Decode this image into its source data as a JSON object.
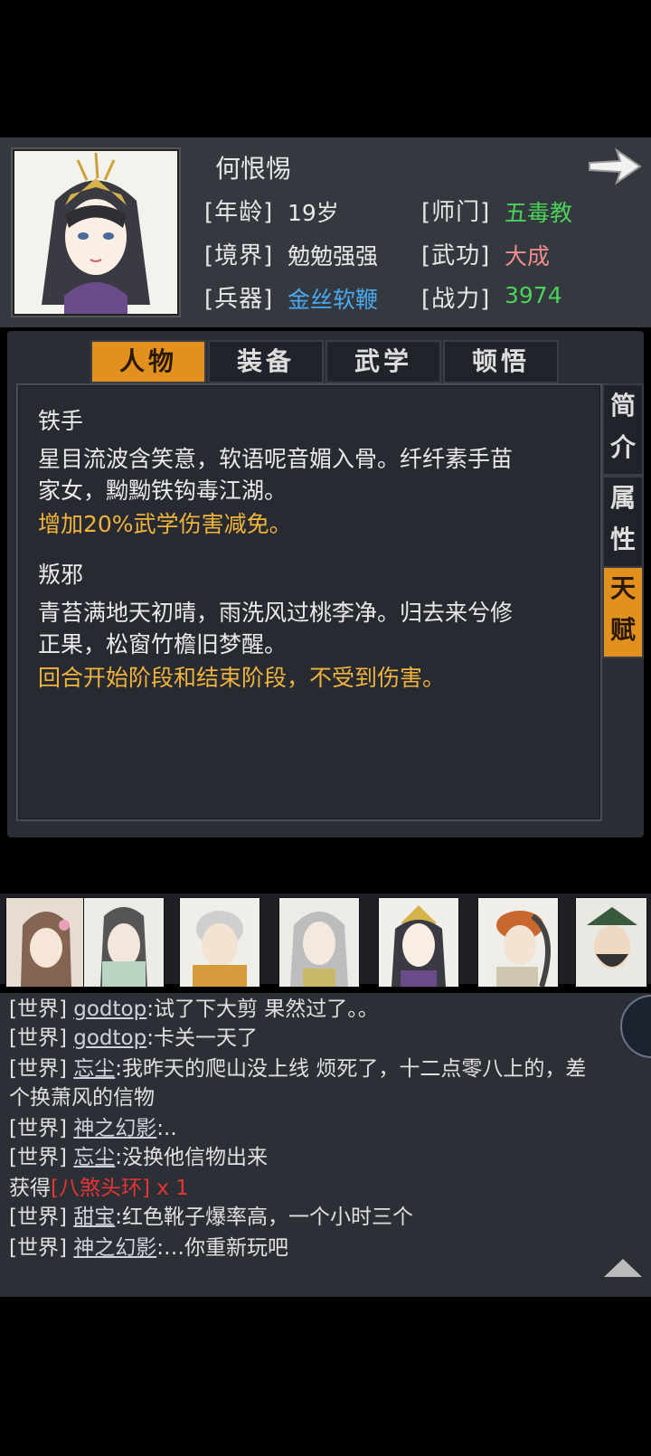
{
  "character": {
    "name": "何恨惕",
    "stats": [
      {
        "label": "[年龄]",
        "value": "19岁",
        "color": "#e6e6e6"
      },
      {
        "label": "[师门]",
        "value": "五毒教",
        "color": "#4cd25a"
      },
      {
        "label": "[境界]",
        "value": "勉勉强强",
        "color": "#e6e6e6"
      },
      {
        "label": "[武功]",
        "value": "大成",
        "color": "#f08c8c"
      },
      {
        "label": "[兵器]",
        "value": "金丝软鞭",
        "color": "#4aa8f0"
      },
      {
        "label": "[战力]",
        "value": "3974",
        "color": "#4cd25a"
      }
    ]
  },
  "tabs": [
    "人物",
    "装备",
    "武学",
    "顿悟"
  ],
  "active_tab": "人物",
  "side_tabs": [
    "简介",
    "属性",
    "天赋"
  ],
  "active_side_tab": "天赋",
  "talents": [
    {
      "name": "铁手",
      "desc_line1": "星目流波含笑意，软语呢音媚入骨。纤纤素手苗",
      "desc_line2": "家女，黝黝铁钩毒江湖。",
      "effect": "增加20%武学伤害减免。"
    },
    {
      "name": "叛邪",
      "desc_line1": "青苔满地天初晴，雨洗风过桃李净。归去来兮修",
      "desc_line2": "正果，松窗竹檐旧梦醒。",
      "effect": "回合开始阶段和结束阶段，不受到伤害。"
    }
  ],
  "chat": [
    {
      "channel": "[世界]",
      "player": "godtop",
      "msg": ":试了下大剪 果然过了。。"
    },
    {
      "channel": "[世界]",
      "player": "godtop",
      "msg": ":卡关一天了"
    },
    {
      "channel": "[世界]",
      "player": "忘尘",
      "msg": ":我昨天的爬山没上线 烦死了，十二点零八上的，差"
    },
    {
      "channel": "",
      "player": "",
      "msg": "个换萧风的信物"
    },
    {
      "channel": "[世界]",
      "player": "神之幻影",
      "msg": ":.."
    },
    {
      "channel": "[世界]",
      "player": "忘尘",
      "msg": ":没换他信物出来"
    },
    {
      "channel": "获得",
      "player": "",
      "msg": "",
      "item": "[八煞头环]",
      "count": " x 1"
    },
    {
      "channel": "[世界]",
      "player": "甜宝",
      "msg": ":红色靴子爆率高，一个小时三个"
    },
    {
      "channel": "[世界]",
      "player": "神之幻影",
      "msg": ":…你重新玩吧"
    }
  ]
}
